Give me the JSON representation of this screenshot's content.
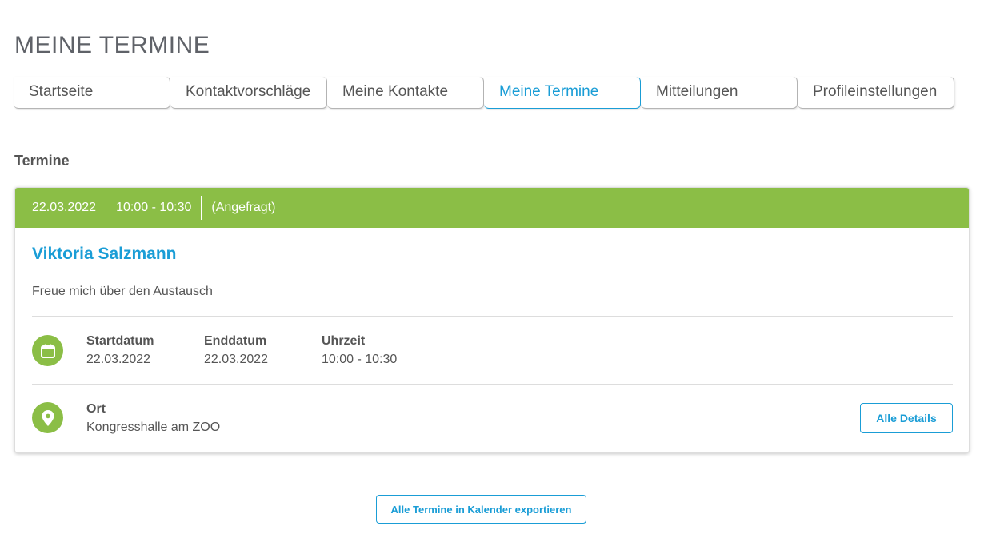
{
  "page": {
    "title": "MEINE TERMINE"
  },
  "tabs": [
    {
      "label": "Startseite"
    },
    {
      "label": "Kontaktvorschläge"
    },
    {
      "label": "Meine Kontakte"
    },
    {
      "label": "Meine Termine"
    },
    {
      "label": "Mitteilungen"
    },
    {
      "label": "Profileinstellungen"
    }
  ],
  "active_tab": "Meine Termine",
  "section": {
    "title": "Termine"
  },
  "appointment": {
    "header": {
      "date": "22.03.2022",
      "time": "10:00 - 10:30",
      "status": "(Angefragt)"
    },
    "person": "Viktoria Salzmann",
    "note": "Freue mich über den Austausch",
    "details": {
      "start_label": "Startdatum",
      "start_value": "22.03.2022",
      "end_label": "Enddatum",
      "end_value": "22.03.2022",
      "time_label": "Uhrzeit",
      "time_value": "10:00 - 10:30"
    },
    "location": {
      "label": "Ort",
      "value": "Kongresshalle am ZOO"
    },
    "details_button": "Alle Details",
    "icons": {
      "date": "calendar-icon",
      "location": "map-pin-icon"
    }
  },
  "export_button": "Alle Termine in Kalender exportieren",
  "colors": {
    "accent": "#1a9dd6",
    "status_green": "#8bbe46",
    "text": "#555555"
  }
}
